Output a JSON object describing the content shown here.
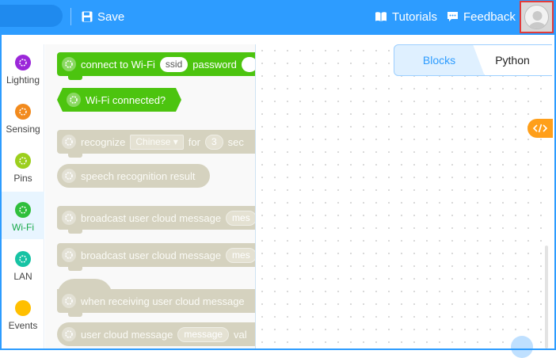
{
  "topbar": {
    "save_label": "Save",
    "tutorials_label": "Tutorials",
    "feedback_label": "Feedback"
  },
  "sidebar": {
    "items": [
      {
        "label": "Lighting",
        "color": "#9b27d9"
      },
      {
        "label": "Sensing",
        "color": "#f28a1d"
      },
      {
        "label": "Pins",
        "color": "#9ccf1d"
      },
      {
        "label": "Wi-Fi",
        "color": "#2fbf3c",
        "selected": true
      },
      {
        "label": "LAN",
        "color": "#16c3a4"
      },
      {
        "label": "Events",
        "color": "#ffbf00"
      }
    ]
  },
  "palette": {
    "connect": {
      "label": "connect to Wi-Fi",
      "ssid": "ssid",
      "password": "password"
    },
    "connected": {
      "label": "Wi-Fi connected?"
    },
    "recognize": {
      "label": "recognize",
      "language": "Chinese ▾",
      "for": "for",
      "seconds_value": "3",
      "seconds_label": "sec"
    },
    "speech_result": {
      "label": "speech recognition result"
    },
    "broadcast1": {
      "label": "broadcast user cloud message",
      "slot": "mes"
    },
    "broadcast2": {
      "label": "broadcast user cloud message",
      "slot": "mes"
    },
    "when_receiving": {
      "label": "when receiving user cloud message"
    },
    "user_cloud": {
      "label": "user cloud message",
      "slot": "message",
      "trail": "val"
    }
  },
  "workspace": {
    "tabs": [
      {
        "label": "Blocks",
        "active": true
      },
      {
        "label": "Python",
        "active": false
      }
    ]
  },
  "colors": {
    "topbar": "#2d9cff",
    "wifi_block": "#4cc40f",
    "disabled_block": "#d5d2bf",
    "code_toggle": "#ff9f1a"
  }
}
